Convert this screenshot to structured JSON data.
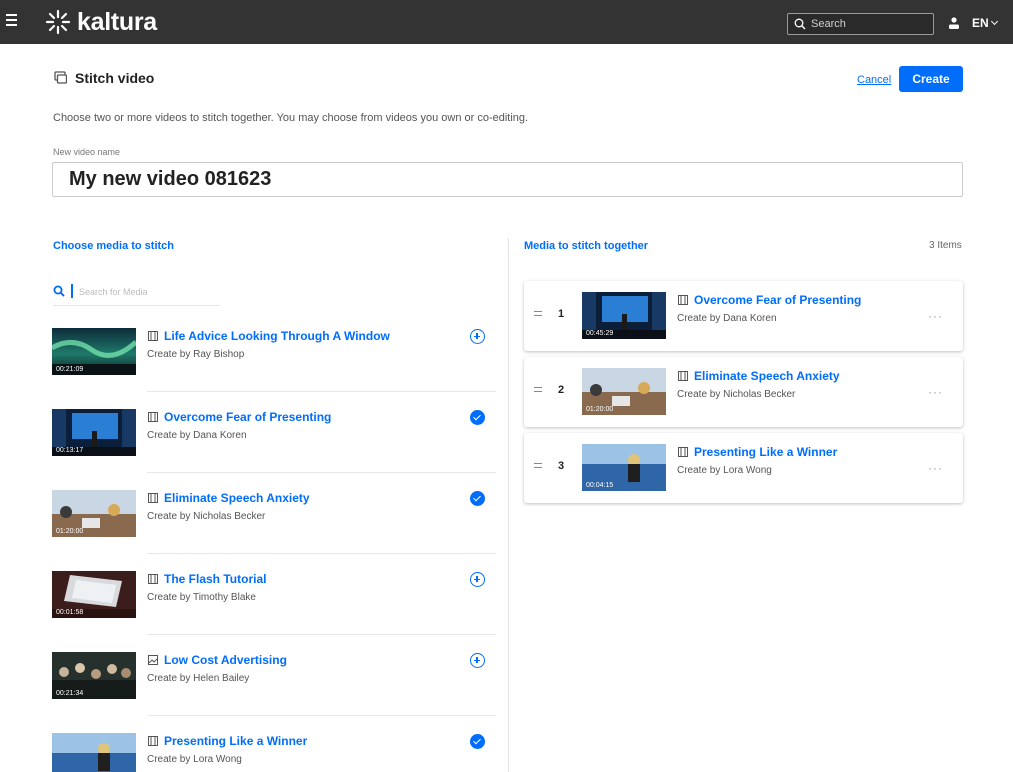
{
  "header": {
    "brand": "kaltura",
    "search_placeholder": "Search",
    "language": "EN"
  },
  "page": {
    "title": "Stitch video",
    "cancel_label": "Cancel",
    "create_label": "Create",
    "description": "Choose two or more videos to stitch together. You may choose from videos you own or co-editing.",
    "name_label": "New video name",
    "name_value": "My new video 081623"
  },
  "left_panel": {
    "heading": "Choose media to stitch",
    "search_placeholder": "Search for Media",
    "items": [
      {
        "title": "Life Advice Looking Through A Window",
        "creator": "Create by Ray Bishop",
        "duration": "00:21:09",
        "type": "video-icon",
        "selected": false
      },
      {
        "title": "Overcome Fear of Presenting",
        "creator": "Create by Dana Koren",
        "duration": "00:13:17",
        "type": "video-icon",
        "selected": true
      },
      {
        "title": "Eliminate Speech Anxiety",
        "creator": "Create by Nicholas Becker",
        "duration": "01:20:00",
        "type": "video-icon",
        "selected": true
      },
      {
        "title": "The Flash Tutorial",
        "creator": "Create by Timothy Blake",
        "duration": "00:01:58",
        "type": "video-icon",
        "selected": false
      },
      {
        "title": "Low Cost Advertising",
        "creator": "Create by Helen Bailey",
        "duration": "00:21:34",
        "type": "image-icon",
        "selected": false
      },
      {
        "title": "Presenting Like a Winner",
        "creator": "Create by Lora Wong",
        "duration": "",
        "type": "video-icon",
        "selected": true
      }
    ]
  },
  "right_panel": {
    "heading": "Media to stitch together",
    "count_label": "3 Items",
    "items": [
      {
        "index": "1",
        "title": "Overcome Fear of Presenting",
        "creator": "Create by Dana Koren",
        "duration": "00:45:29"
      },
      {
        "index": "2",
        "title": "Eliminate Speech Anxiety",
        "creator": "Create by Nicholas Becker",
        "duration": "01:20:00"
      },
      {
        "index": "3",
        "title": "Presenting Like a Winner",
        "creator": "Create by Lora Wong",
        "duration": "00:04:15"
      }
    ],
    "more_label": "···"
  },
  "colors": {
    "accent": "#006efa",
    "topbar": "#333333"
  }
}
